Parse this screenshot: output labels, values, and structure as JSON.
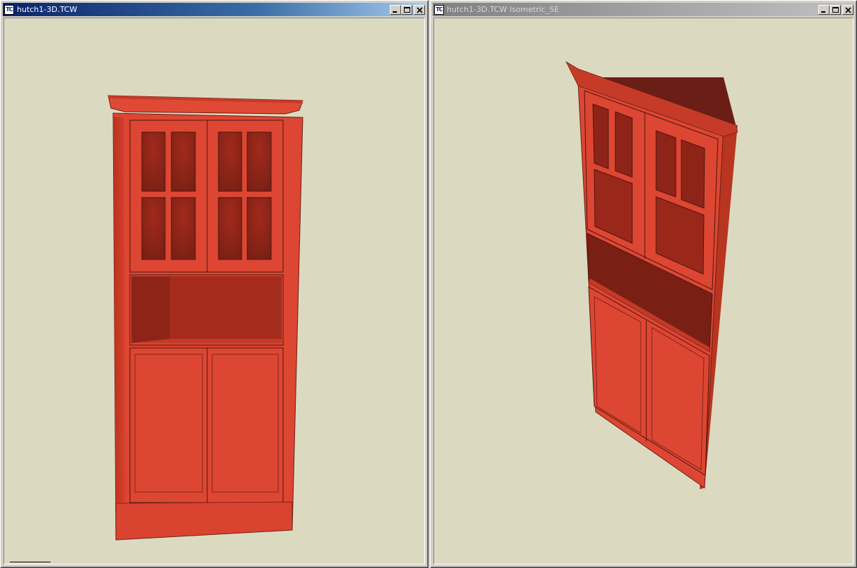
{
  "windows": [
    {
      "title": "hutch1-3D.TCW",
      "active": true,
      "icon": "tc-app-icon"
    },
    {
      "title": "hutch1-3D.TCW Isometric_SE",
      "active": false,
      "icon": "tc-app-icon"
    }
  ],
  "caption_buttons": [
    "minimize-icon",
    "maximize-icon",
    "close-icon"
  ],
  "viewport": {
    "background": "#dbdac1",
    "model_color": "#dd4632",
    "model_shadow": "#6b1e16"
  }
}
